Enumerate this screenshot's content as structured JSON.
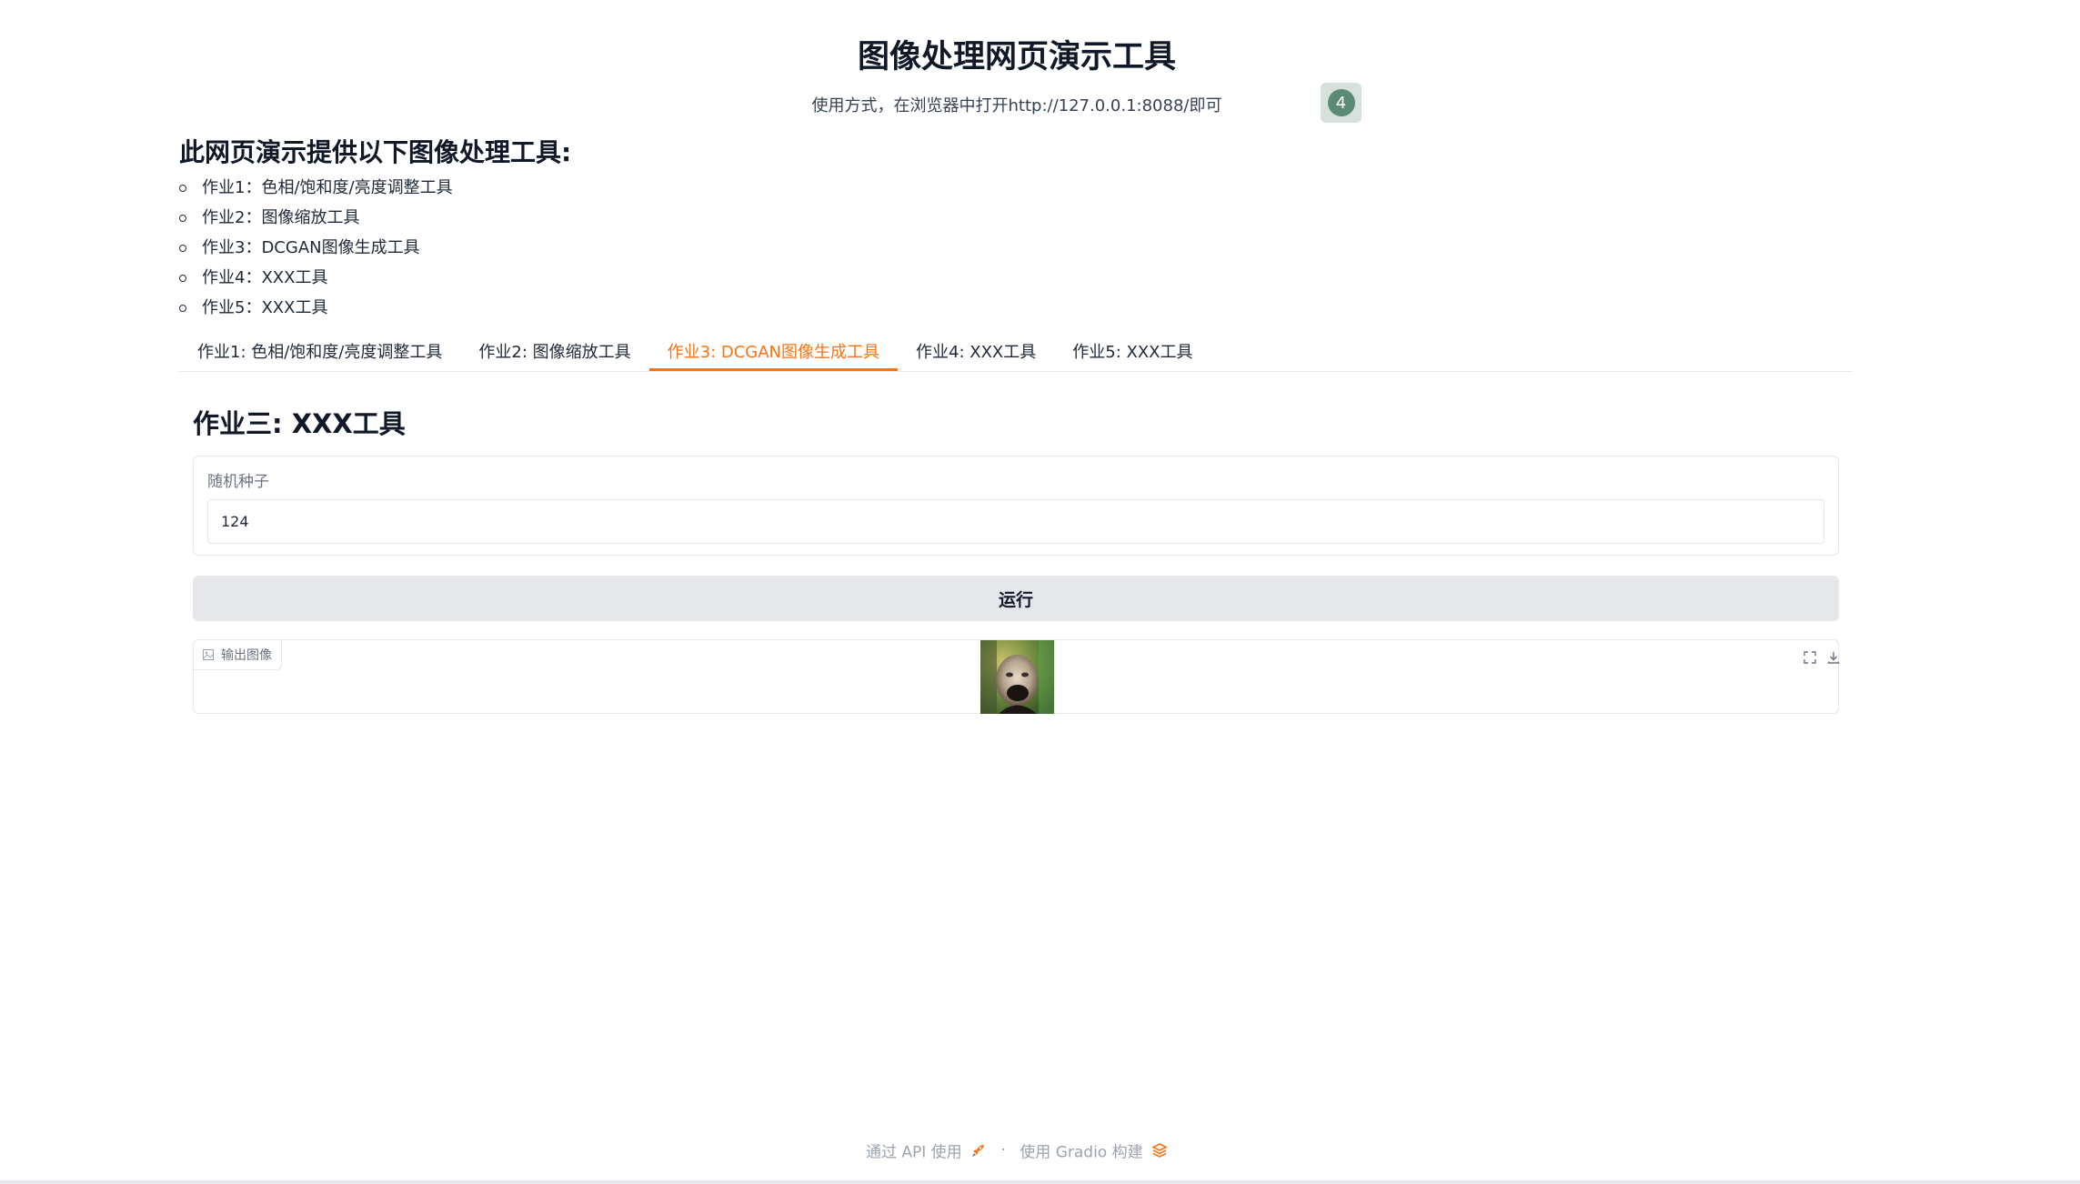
{
  "header": {
    "title": "图像处理网页演示工具",
    "subtitle": "使用方式，在浏览器中打开http://127.0.0.1:8088/即可",
    "badge_value": "4"
  },
  "intro": {
    "heading": "此网页演示提供以下图像处理工具:",
    "items": [
      "作业1：色相/饱和度/亮度调整工具",
      "作业2：图像缩放工具",
      "作业3：DCGAN图像生成工具",
      "作业4：XXX工具",
      "作业5：XXX工具"
    ]
  },
  "tabs": [
    {
      "label": "作业1: 色相/饱和度/亮度调整工具",
      "active": false
    },
    {
      "label": "作业2: 图像缩放工具",
      "active": false
    },
    {
      "label": "作业3: DCGAN图像生成工具",
      "active": true
    },
    {
      "label": "作业4: XXX工具",
      "active": false
    },
    {
      "label": "作业5: XXX工具",
      "active": false
    }
  ],
  "main": {
    "section_title": "作业三: XXX工具",
    "seed_label": "随机种子",
    "seed_value": "124",
    "run_label": "运行",
    "output_label": "输出图像",
    "icons": {
      "output": "image-icon",
      "fullscreen": "fullscreen-icon",
      "download": "download-icon"
    }
  },
  "footer": {
    "api_text": "通过 API 使用",
    "separator": "·",
    "built_text": "使用 Gradio 构建",
    "icons": {
      "api": "rocket-icon",
      "gradio": "gradio-logo-icon"
    }
  },
  "colors": {
    "accent": "#f97316",
    "badge_bg": "#d6e1dc",
    "badge_fg": "#5b8a76",
    "button_bg": "#e5e7eb",
    "border": "#e5e7eb"
  }
}
